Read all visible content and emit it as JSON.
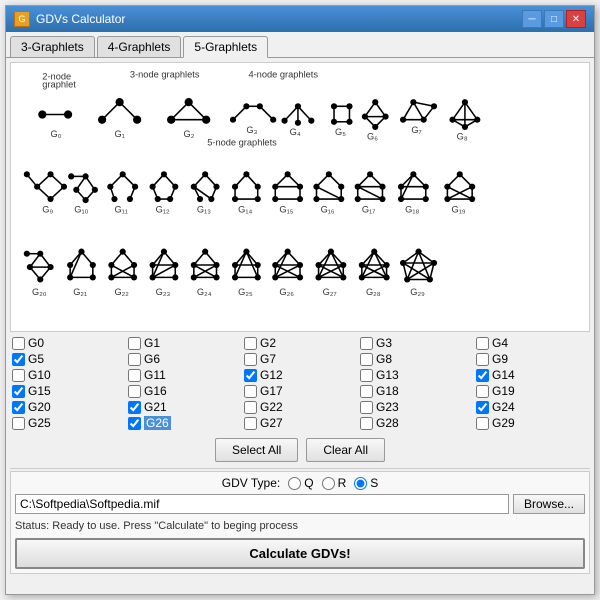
{
  "window": {
    "title": "GDVs Calculator",
    "icon": "G"
  },
  "tabs": [
    {
      "id": "3g",
      "label": "3-Graphlets"
    },
    {
      "id": "4g",
      "label": "4-Graphlets"
    },
    {
      "id": "5g",
      "label": "5-Graphlets",
      "active": true
    }
  ],
  "buttons": {
    "select_all": "Select All",
    "clear_all": "Clear All",
    "browse": "Browse...",
    "calculate": "Calculate GDVs!"
  },
  "gdv_type": {
    "label": "GDV Type:",
    "options": [
      "Q",
      "R",
      "S"
    ],
    "selected": "S"
  },
  "file_path": "C:\\Softpedia\\Softpedia.mif",
  "status": "Status: Ready to use.  Press \"Calculate\" to beging process",
  "checkboxes": [
    {
      "id": "G0",
      "checked": false
    },
    {
      "id": "G1",
      "checked": false
    },
    {
      "id": "G2",
      "checked": false
    },
    {
      "id": "G3",
      "checked": false
    },
    {
      "id": "G4",
      "checked": false
    },
    {
      "id": "G5",
      "checked": true
    },
    {
      "id": "G6",
      "checked": false
    },
    {
      "id": "G7",
      "checked": false
    },
    {
      "id": "G8",
      "checked": false
    },
    {
      "id": "G9",
      "checked": false
    },
    {
      "id": "G10",
      "checked": false
    },
    {
      "id": "G11",
      "checked": false
    },
    {
      "id": "G12",
      "checked": true
    },
    {
      "id": "G13",
      "checked": false
    },
    {
      "id": "G14",
      "checked": true
    },
    {
      "id": "G15",
      "checked": true
    },
    {
      "id": "G16",
      "checked": false
    },
    {
      "id": "G17",
      "checked": false
    },
    {
      "id": "G18",
      "checked": false
    },
    {
      "id": "G19",
      "checked": false
    },
    {
      "id": "G20",
      "checked": true
    },
    {
      "id": "G21",
      "checked": true
    },
    {
      "id": "G22",
      "checked": false
    },
    {
      "id": "G23",
      "checked": false
    },
    {
      "id": "G24",
      "checked": true
    },
    {
      "id": "G25",
      "checked": false
    },
    {
      "id": "G26",
      "checked": true,
      "highlighted": true
    },
    {
      "id": "G27",
      "checked": false
    },
    {
      "id": "G28",
      "checked": false
    },
    {
      "id": "G29",
      "checked": false
    }
  ]
}
